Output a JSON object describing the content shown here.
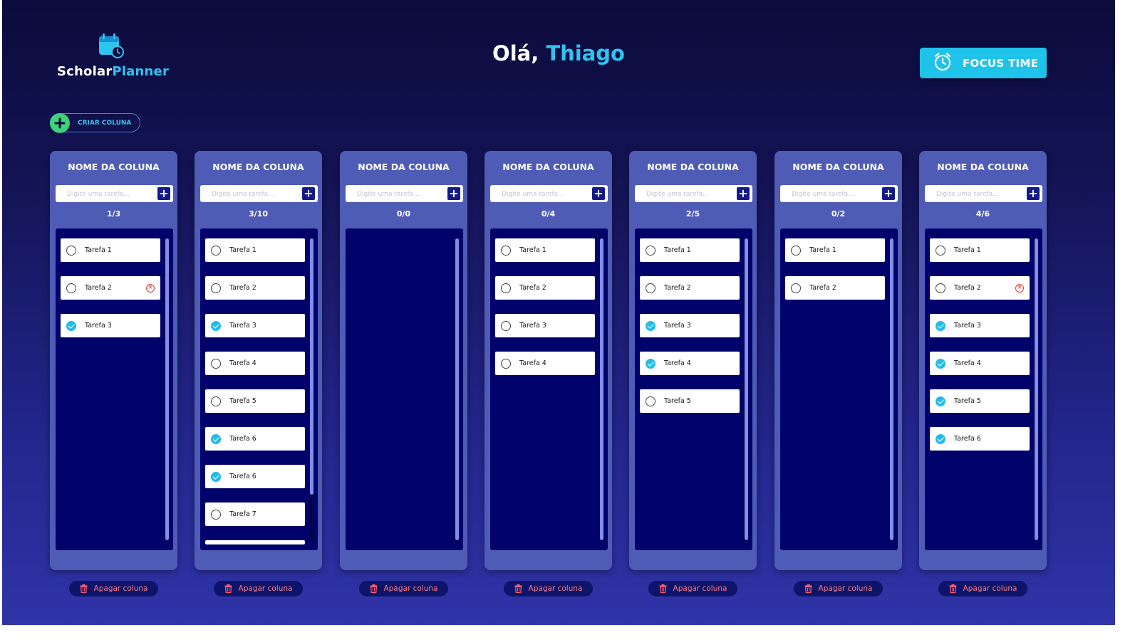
{
  "app": {
    "logo_part1": "Scholar",
    "logo_part2": "Planner",
    "greeting_prefix": "Olá, ",
    "user_name": "Thiago",
    "focus_label": "FOCUS TIME",
    "create_column_label": "CRIAR COLUNA",
    "delete_column_label": "Apagar coluna",
    "task_placeholder": "Digite uma tarefa...",
    "icons": {
      "logo": "calendar-clock-icon",
      "focus": "alarm-clock-icon",
      "create": "plus-icon",
      "add_task": "plus-icon",
      "delete_task": "x-circle-icon",
      "delete_column": "trash-icon"
    },
    "colors": {
      "accent": "#2ec4f0",
      "focus_button": "#1fc2e8",
      "create_plus": "#3ed27a",
      "column_bg": "#4f5cb5",
      "task_area": "#02026b",
      "done_check": "#21bdea",
      "delete_text": "#ff7a8a",
      "delete_icon": "#e0362e"
    }
  },
  "columns": [
    {
      "title": "NOME DA COLUNA",
      "count": "1/3",
      "scroll_fraction": 1,
      "tasks": [
        {
          "label": "Tarefa 1",
          "done": false,
          "deletable": false
        },
        {
          "label": "Tarefa 2",
          "done": false,
          "deletable": true
        },
        {
          "label": "Tarefa 3",
          "done": true,
          "deletable": false
        }
      ]
    },
    {
      "title": "NOME DA COLUNA",
      "count": "3/10",
      "scroll_fraction": 0.85,
      "tasks": [
        {
          "label": "Tarefa 1",
          "done": false,
          "deletable": false
        },
        {
          "label": "Tarefa 2",
          "done": false,
          "deletable": false
        },
        {
          "label": "Tarefa 3",
          "done": true,
          "deletable": false
        },
        {
          "label": "Tarefa 4",
          "done": false,
          "deletable": false
        },
        {
          "label": "Tarefa 5",
          "done": false,
          "deletable": false
        },
        {
          "label": "Tarefa 6",
          "done": true,
          "deletable": false
        },
        {
          "label": "Tarefa 6",
          "done": true,
          "deletable": false
        },
        {
          "label": "Tarefa 7",
          "done": false,
          "deletable": false
        }
      ],
      "has_overflow_task": true
    },
    {
      "title": "NOME DA COLUNA",
      "count": "0/0",
      "scroll_fraction": 1,
      "tasks": []
    },
    {
      "title": "NOME DA COLUNA",
      "count": "0/4",
      "scroll_fraction": 1,
      "tasks": [
        {
          "label": "Tarefa 1",
          "done": false,
          "deletable": false
        },
        {
          "label": "Tarefa 2",
          "done": false,
          "deletable": false
        },
        {
          "label": "Tarefa 3",
          "done": false,
          "deletable": false
        },
        {
          "label": "Tarefa 4",
          "done": false,
          "deletable": false
        }
      ]
    },
    {
      "title": "NOME DA COLUNA",
      "count": "2/5",
      "scroll_fraction": 1,
      "tasks": [
        {
          "label": "Tarefa 1",
          "done": false,
          "deletable": false
        },
        {
          "label": "Tarefa 2",
          "done": false,
          "deletable": false
        },
        {
          "label": "Tarefa 3",
          "done": true,
          "deletable": false
        },
        {
          "label": "Tarefa 4",
          "done": true,
          "deletable": false
        },
        {
          "label": "Tarefa 5",
          "done": false,
          "deletable": false
        }
      ]
    },
    {
      "title": "NOME DA COLUNA",
      "count": "0/2",
      "scroll_fraction": 1,
      "tasks": [
        {
          "label": "Tarefa 1",
          "done": false,
          "deletable": false
        },
        {
          "label": "Tarefa 2",
          "done": false,
          "deletable": false
        }
      ]
    },
    {
      "title": "NOME DA COLUNA",
      "count": "4/6",
      "scroll_fraction": 1,
      "tasks": [
        {
          "label": "Tarefa 1",
          "done": false,
          "deletable": false
        },
        {
          "label": "Tarefa 2",
          "done": false,
          "deletable": true
        },
        {
          "label": "Tarefa 3",
          "done": true,
          "deletable": false
        },
        {
          "label": "Tarefa 4",
          "done": true,
          "deletable": false
        },
        {
          "label": "Tarefa 5",
          "done": true,
          "deletable": false
        },
        {
          "label": "Tarefa 6",
          "done": true,
          "deletable": false
        }
      ]
    }
  ]
}
